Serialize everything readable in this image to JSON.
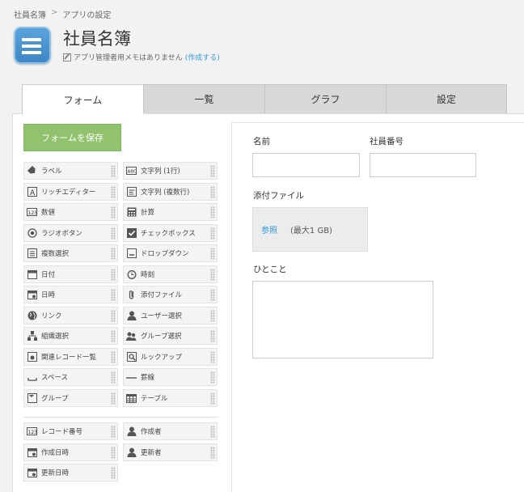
{
  "breadcrumb": {
    "home": "社員名簿",
    "separator": ">",
    "current": "アプリの設定"
  },
  "app": {
    "title": "社員名簿",
    "memo_text": "アプリ管理者用メモはありません",
    "memo_link": "(作成する)",
    "icon": "list-icon",
    "accent_color": "#4a90d0"
  },
  "tabs": [
    {
      "label": "フォーム",
      "active": true
    },
    {
      "label": "一覧",
      "active": false
    },
    {
      "label": "グラフ",
      "active": false
    },
    {
      "label": "設定",
      "active": false
    }
  ],
  "save_button": {
    "label": "フォームを保存",
    "color": "#91c36f"
  },
  "palette": {
    "left": [
      {
        "label": "ラベル",
        "icon": "tag-icon"
      },
      {
        "label": "リッチエディター",
        "icon": "rich-text-icon"
      },
      {
        "label": "数値",
        "icon": "number-icon"
      },
      {
        "label": "ラジオボタン",
        "icon": "radio-icon"
      },
      {
        "label": "複数選択",
        "icon": "multi-select-icon"
      },
      {
        "label": "日付",
        "icon": "calendar-icon"
      },
      {
        "label": "日時",
        "icon": "calendar-clock-icon"
      },
      {
        "label": "リンク",
        "icon": "globe-icon"
      },
      {
        "label": "組織選択",
        "icon": "org-icon"
      },
      {
        "label": "関連レコード一覧",
        "icon": "related-records-icon"
      },
      {
        "label": "スペース",
        "icon": "space-icon"
      },
      {
        "label": "グループ",
        "icon": "group-icon"
      }
    ],
    "right": [
      {
        "label": "文字列 (1行)",
        "icon": "text-single-icon"
      },
      {
        "label": "文字列 (複数行)",
        "icon": "text-multi-icon"
      },
      {
        "label": "計算",
        "icon": "calculator-icon"
      },
      {
        "label": "チェックボックス",
        "icon": "checkbox-icon"
      },
      {
        "label": "ドロップダウン",
        "icon": "dropdown-icon"
      },
      {
        "label": "時刻",
        "icon": "clock-icon"
      },
      {
        "label": "添付ファイル",
        "icon": "paperclip-icon"
      },
      {
        "label": "ユーザー選択",
        "icon": "user-icon"
      },
      {
        "label": "グループ選択",
        "icon": "users-icon"
      },
      {
        "label": "ルックアップ",
        "icon": "lookup-icon"
      },
      {
        "label": "罫線",
        "icon": "line-icon"
      },
      {
        "label": "テーブル",
        "icon": "table-icon"
      }
    ],
    "system_left": [
      {
        "label": "レコード番号",
        "icon": "number-icon"
      },
      {
        "label": "作成日時",
        "icon": "calendar-icon"
      },
      {
        "label": "更新日時",
        "icon": "calendar-icon"
      }
    ],
    "system_right": [
      {
        "label": "作成者",
        "icon": "user-icon"
      },
      {
        "label": "更新者",
        "icon": "user-icon"
      }
    ]
  },
  "form": {
    "name_label": "名前",
    "employee_no_label": "社員番号",
    "attachment_label": "添付ファイル",
    "attachment_browse": "参照",
    "attachment_max": "(最大1 GB)",
    "comment_label": "ひとこと"
  }
}
